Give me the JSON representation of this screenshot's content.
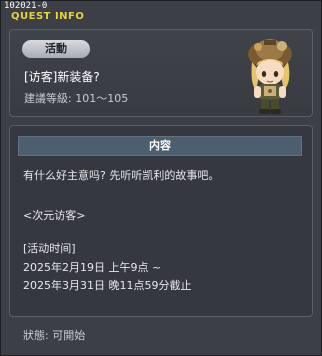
{
  "header": {
    "quest_id": "102021-0",
    "title": "QUEST INFO"
  },
  "summary": {
    "tag": "活動",
    "name": "[访客]新装备?",
    "level": "建議等級: 101～105"
  },
  "content": {
    "header": "内容",
    "lines": [
      "有什么好主意吗? 先听听凯利的故事吧。",
      "<次元访客>",
      "[活动时间]",
      "2025年2月19日 上午9点 ~",
      "2025年3月31日 晚11点59分截止"
    ]
  },
  "footer": {
    "status": "狀態: 可開始"
  },
  "colors": {
    "title": "#e8d23a",
    "header_bar": "#4c5f6f",
    "panel_border": "#5a5f67"
  },
  "icons": {
    "avatar": "npc-character-portrait"
  }
}
